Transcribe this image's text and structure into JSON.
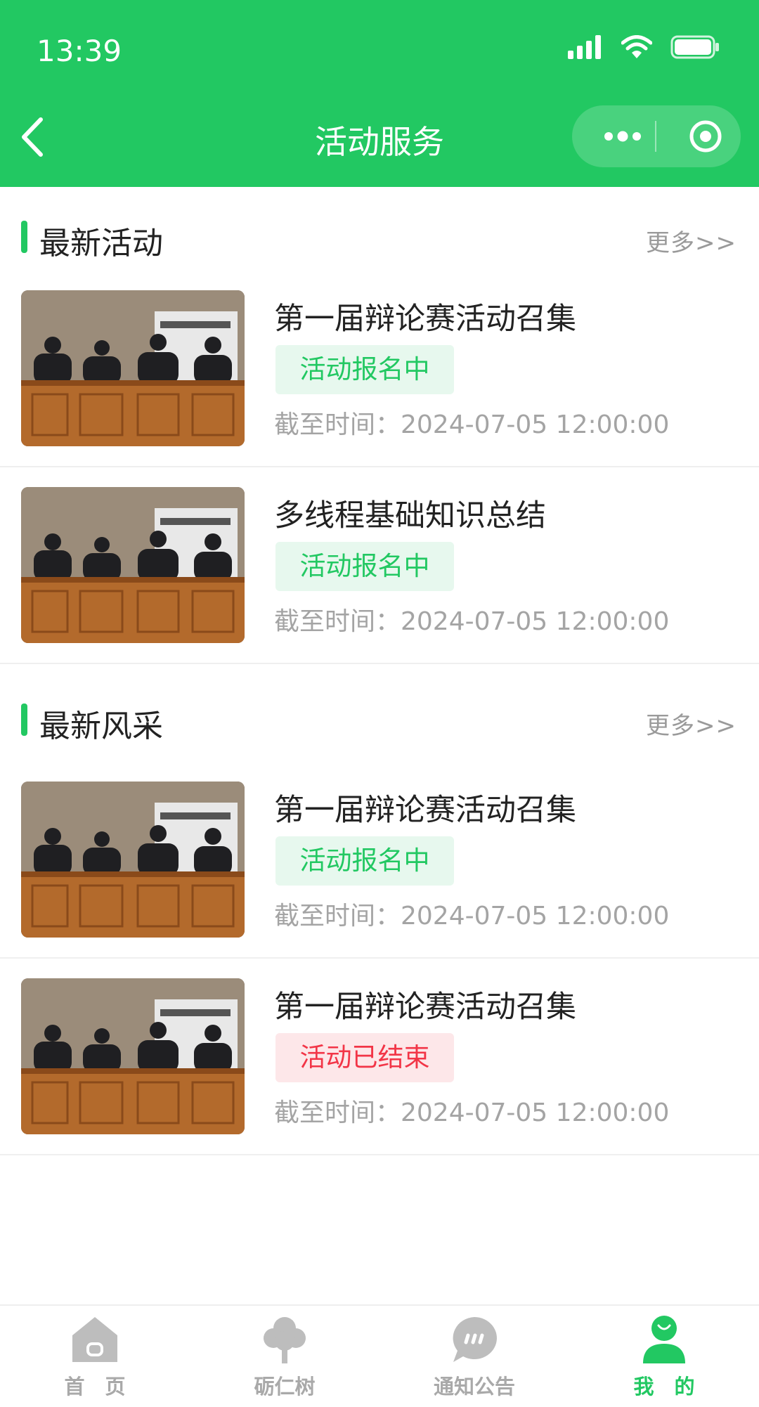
{
  "status_bar": {
    "time": "13:39"
  },
  "nav": {
    "title": "活动服务"
  },
  "sections": [
    {
      "title": "最新活动",
      "more": "更多>>",
      "items": [
        {
          "title": "第一届辩论赛活动召集",
          "badge": "活动报名中",
          "status": "open",
          "deadline": "截至时间：2024-07-05 12:00:00"
        },
        {
          "title": "多线程基础知识总结",
          "badge": "活动报名中",
          "status": "open",
          "deadline": "截至时间：2024-07-05 12:00:00"
        }
      ]
    },
    {
      "title": "最新风采",
      "more": "更多>>",
      "items": [
        {
          "title": "第一届辩论赛活动召集",
          "badge": "活动报名中",
          "status": "open",
          "deadline": "截至时间：2024-07-05 12:00:00"
        },
        {
          "title": "第一届辩论赛活动召集",
          "badge": "活动已结束",
          "status": "ended",
          "deadline": "截至时间：2024-07-05 12:00:00"
        }
      ]
    }
  ],
  "tabbar": [
    {
      "label": "首　页",
      "icon": "home-icon",
      "active": false
    },
    {
      "label": "砺仁树",
      "icon": "tree-icon",
      "active": false
    },
    {
      "label": "通知公告",
      "icon": "chat-bubble-icon",
      "active": false
    },
    {
      "label": "我　的",
      "icon": "user-icon",
      "active": true
    }
  ],
  "colors": {
    "primary": "#22c862",
    "badge_open_bg": "#e7f8ee",
    "badge_ended_bg": "#fde7e9",
    "badge_ended_text": "#f23547",
    "muted": "#a4a4a4"
  }
}
